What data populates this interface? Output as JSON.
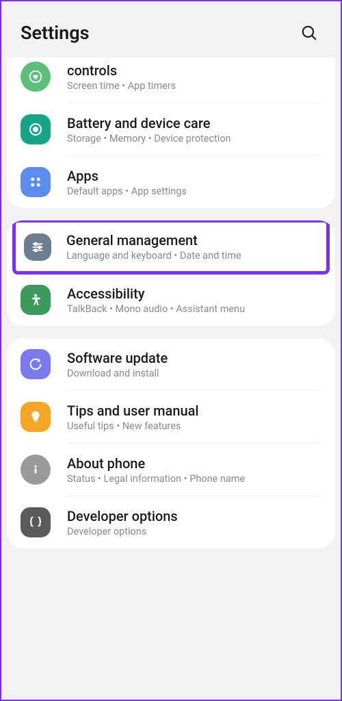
{
  "header": {
    "title": "Settings"
  },
  "groups": [
    {
      "items": [
        {
          "key": "controls",
          "title": "controls",
          "sub": "Screen time  •  App timers",
          "icon": "heart-circle",
          "bg": "bg-green1"
        },
        {
          "key": "battery",
          "title": "Battery and device care",
          "sub": "Storage  •  Memory  •  Device protection",
          "icon": "care-circle",
          "bg": "bg-teal",
          "shape": "round-sq"
        },
        {
          "key": "apps",
          "title": "Apps",
          "sub": "Default apps  •  App settings",
          "icon": "grid-dots",
          "bg": "bg-blue",
          "shape": "round-sq"
        }
      ]
    },
    {
      "items": [
        {
          "key": "general",
          "title": "General management",
          "sub": "Language and keyboard  •  Date and time",
          "icon": "sliders",
          "bg": "bg-slate",
          "shape": "round-sq",
          "highlight": true
        },
        {
          "key": "accessibility",
          "title": "Accessibility",
          "sub": "TalkBack  •  Mono audio  •  Assistant menu",
          "icon": "person",
          "bg": "bg-green2",
          "shape": "round-sq"
        }
      ]
    },
    {
      "items": [
        {
          "key": "update",
          "title": "Software update",
          "sub": "Download and install",
          "icon": "refresh",
          "bg": "bg-indigo",
          "shape": "round-sq"
        },
        {
          "key": "tips",
          "title": "Tips and user manual",
          "sub": "Useful tips  •  New features",
          "icon": "bulb",
          "bg": "bg-orange",
          "shape": "round-sq"
        },
        {
          "key": "about",
          "title": "About phone",
          "sub": "Status  •  Legal information  •  Phone name",
          "icon": "info",
          "bg": "bg-gray"
        },
        {
          "key": "dev",
          "title": "Developer options",
          "sub": "Developer options",
          "icon": "braces",
          "bg": "bg-dark",
          "shape": "round-sq"
        }
      ]
    }
  ]
}
